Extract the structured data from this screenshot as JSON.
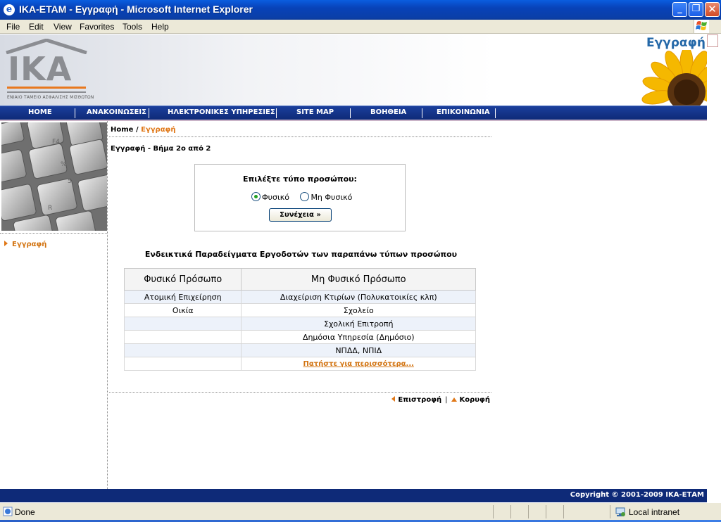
{
  "window": {
    "title": "ΙΚΑ-ΕΤΑΜ - Εγγραφή - Microsoft Internet Explorer",
    "icon": "ie-icon",
    "controls": [
      "minimize-icon",
      "maximize-icon",
      "close-icon"
    ]
  },
  "menu": [
    "File",
    "Edit",
    "View",
    "Favorites",
    "Tools",
    "Help"
  ],
  "header": {
    "logo_text": "IKA",
    "logo_subtitle": "ΕΝΙΑΙΟ ΤΑΜΕΙΟ ΑΣΦΑΛΙΣΗΣ ΜΙΣΘΩΤΩΝ",
    "page_title": "Εγγραφή"
  },
  "nav": [
    "HOME",
    "ΑΝΑΚΟΙΝΩΣΕΙΣ",
    "ΗΛΕΚΤΡΟΝΙΚΕΣ ΥΠΗΡΕΣΙΕΣ",
    "SITE MAP",
    "ΒΟΗΘΕΙΑ",
    "ΕΠΙΚΟΙΝΩΝΙΑ"
  ],
  "sidebar": {
    "link": "Εγγραφή"
  },
  "breadcrumb": {
    "home": "Home",
    "sep": "/",
    "current": "Εγγραφή"
  },
  "step_text": "Εγγραφή - Βήμα 2ο από 2",
  "select": {
    "question": "Επιλέξτε τύπο προσώπου:",
    "options": [
      "Φυσικό",
      "Μη Φυσικό"
    ],
    "selected": "Φυσικό",
    "button": "Συνέχεια »"
  },
  "examples": {
    "title": "Ενδεικτικά Παραδείγματα Εργοδοτών των παραπάνω τύπων προσώπου",
    "headers": [
      "Φυσικό Πρόσωπο",
      "Μη Φυσικό Πρόσωπο"
    ],
    "rows": [
      [
        "Ατομική Επιχείρηση",
        "Διαχείριση Κτιρίων (Πολυκατοικίες κλπ)"
      ],
      [
        "Οικία",
        "Σχολείο"
      ],
      [
        "",
        "Σχολική Επιτροπή"
      ],
      [
        "",
        "Δημόσια Υπηρεσία (Δημόσιο)"
      ],
      [
        "",
        "ΝΠΔΔ, ΝΠΙΔ"
      ]
    ],
    "more_link": "Πατήστε για περισσότερα..."
  },
  "footer_links": {
    "back": "Επιστροφή",
    "pipe": "|",
    "top": "Κορυφή"
  },
  "copyright": "Copyright © 2001-2009 ΙΚΑ-ΕΤΑΜ",
  "status": {
    "left": "Done",
    "zone": "Local intranet"
  },
  "colors": {
    "nav_blue": "#0e2a78",
    "accent_orange": "#e07818",
    "title_blue": "#2468a8"
  }
}
